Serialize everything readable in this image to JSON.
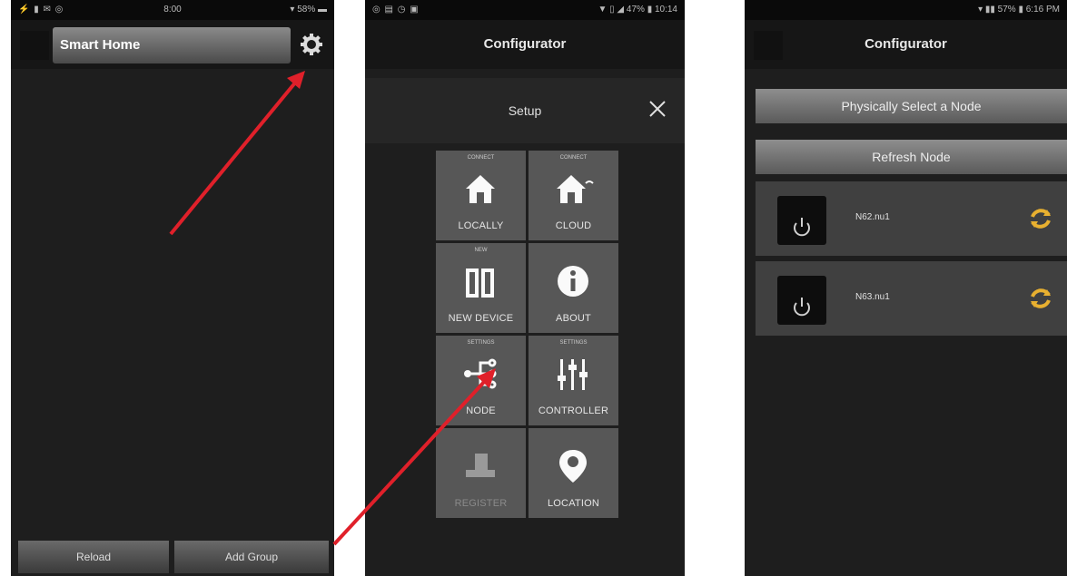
{
  "phone1": {
    "status_left": "⚡ ▮ ✉ ◎",
    "status_center": "8:00",
    "status_right": "▾ 58% ▬",
    "title": "Smart Home",
    "gear_icon": "gear-icon",
    "reload_label": "Reload",
    "add_group_label": "Add Group"
  },
  "phone2": {
    "status_left": "◎ ▤ ◷ ▣",
    "status_right": "▼ ▯ ◢ 47% ▮ 10:14",
    "title": "Configurator",
    "setup_title": "Setup",
    "tiles": [
      {
        "sub": "CONNECT",
        "label": "LOCALLY",
        "icon": "house-icon"
      },
      {
        "sub": "CONNECT",
        "label": "CLOUD",
        "icon": "house-cloud-icon"
      },
      {
        "sub": "NEW",
        "label": "NEW DEVICE",
        "icon": "device-icon"
      },
      {
        "sub": "",
        "label": "ABOUT",
        "icon": "info-icon"
      },
      {
        "sub": "SETTINGS",
        "label": "NODE",
        "icon": "node-icon"
      },
      {
        "sub": "SETTINGS",
        "label": "CONTROLLER",
        "icon": "sliders-icon"
      },
      {
        "sub": "",
        "label": "REGISTER",
        "icon": "register-icon"
      },
      {
        "sub": "",
        "label": "LOCATION",
        "icon": "location-pin-icon"
      }
    ]
  },
  "phone3": {
    "status_right": "▾ ▮▮ 57% ▮ 6:16 PM",
    "title": "Configurator",
    "select_node_label": "Physically Select a Node",
    "refresh_node_label": "Refresh Node",
    "nodes": [
      {
        "name": "N62.nu1",
        "icon": "power-icon"
      },
      {
        "name": "N63.nu1",
        "icon": "power-icon"
      }
    ]
  },
  "colors": {
    "arrow": "#e0202a",
    "tile": "#575757",
    "sync": "#e8b030"
  }
}
